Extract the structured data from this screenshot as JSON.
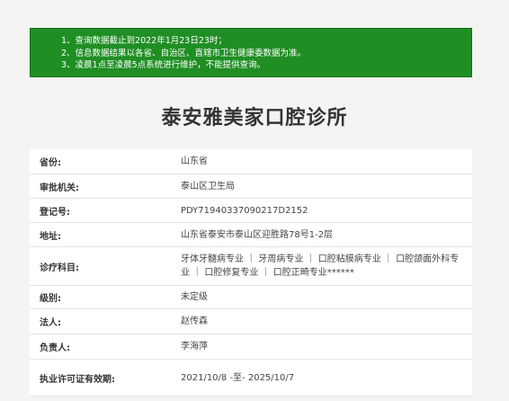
{
  "notice": {
    "lines": [
      "1、查询数据截止到2022年1月23日23时；",
      "2、信息数据结果以各省、自治区、直辖市卫生健康委数据为准。",
      "3、凌晨1点至凌晨5点系统进行维护，不能提供查询。"
    ]
  },
  "page_title": "泰安雅美家口腔诊所",
  "rows": [
    {
      "label": "省份:",
      "value": "山东省"
    },
    {
      "label": "审批机关:",
      "value": "泰山区卫生局"
    },
    {
      "label": "登记号:",
      "value": "PDY71940337090217D2152"
    },
    {
      "label": "地址:",
      "value": "山东省泰安市泰山区迎胜路78号1-2层"
    },
    {
      "label": "诊疗科目:",
      "value": "牙体牙髓病专业 ｜ 牙周病专业 ｜ 口腔粘膜病专业 ｜ 口腔颌面外科专业 ｜ 口腔修复专业 ｜ 口腔正畸专业******"
    },
    {
      "label": "级别:",
      "value": "未定级"
    },
    {
      "label": "法人:",
      "value": "赵传森"
    },
    {
      "label": "负责人:",
      "value": "李海萍"
    },
    {
      "label": "执业许可证有效期:",
      "value": "2021/10/8 -至- 2025/10/7"
    }
  ],
  "colors": {
    "notice_bg": "#1f8f24",
    "page_bg": "#f4f4f2",
    "table_bg": "#ffffff"
  }
}
